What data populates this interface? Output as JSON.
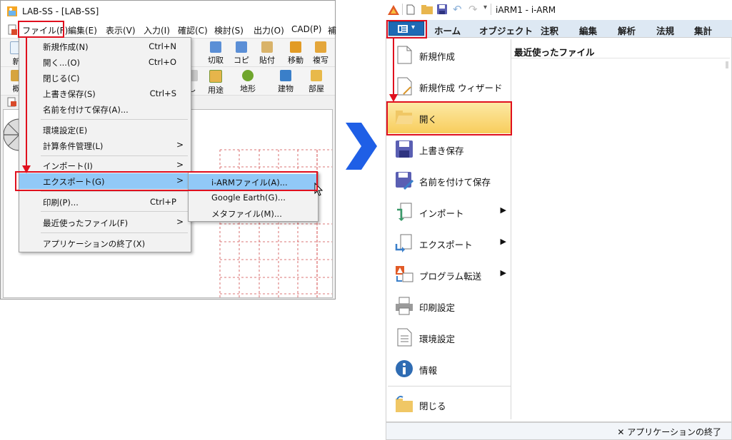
{
  "left_window": {
    "title": "LAB-SS - [LAB-SS]",
    "menubar": [
      "ファイル(F)",
      "編集(E)",
      "表示(V)",
      "入力(I)",
      "確認(C)",
      "検討(S)",
      "出力(O)",
      "CAD(P)",
      "補"
    ],
    "toolbar1": [
      {
        "label": "新",
        "icon": "new-doc-icon"
      },
      {
        "label": "切取",
        "icon": "cut-icon"
      },
      {
        "label": "コピー",
        "icon": "copy-icon"
      },
      {
        "label": "貼付",
        "icon": "paste-icon"
      },
      {
        "label": "移動",
        "icon": "truck-move-icon"
      },
      {
        "label": "複写",
        "icon": "duplicate-icon"
      }
    ],
    "toolbar2": [
      {
        "label": "概",
        "icon": "overview-icon"
      },
      {
        "label": "し",
        "icon": "misc-icon"
      },
      {
        "label": "用途",
        "icon": "usage-icon"
      },
      {
        "label": "地形",
        "icon": "terrain-icon"
      },
      {
        "label": "建物",
        "icon": "building-icon"
      },
      {
        "label": "部屋",
        "icon": "room-icon"
      }
    ],
    "file_menu": [
      {
        "label": "新規作成(N)",
        "shortcut": "Ctrl+N"
      },
      {
        "label": "開く...(O)",
        "shortcut": "Ctrl+O"
      },
      {
        "label": "閉じる(C)",
        "shortcut": ""
      },
      {
        "label": "上書き保存(S)",
        "shortcut": "Ctrl+S"
      },
      {
        "label": "名前を付けて保存(A)...",
        "shortcut": ""
      },
      {
        "label": "環境設定(E)",
        "shortcut": ""
      },
      {
        "label": "計算条件管理(L)",
        "shortcut": "",
        "submenu": true
      },
      {
        "label": "インポート(I)",
        "shortcut": "",
        "submenu": true
      },
      {
        "label": "エクスポート(G)",
        "shortcut": "",
        "submenu": true,
        "highlighted": true
      },
      {
        "label": "印刷(P)...",
        "shortcut": "Ctrl+P"
      },
      {
        "label": "最近使ったファイル(F)",
        "shortcut": "",
        "submenu": true
      },
      {
        "label": "アプリケーションの終了(X)",
        "shortcut": ""
      }
    ],
    "submenu_arrow": ">",
    "export_submenu": [
      "i-ARMファイル(A)...",
      "Google Earth(G)...",
      "メタファイル(M)..."
    ]
  },
  "right_window": {
    "title": "iARM1 - i-ARM",
    "ribbon_tabs": [
      "ホーム",
      "オブジェクト",
      "注釈",
      "編集",
      "解析",
      "法規",
      "集計"
    ],
    "file_menu": [
      {
        "label": "新規作成",
        "icon": "new-doc-icon"
      },
      {
        "label": "新規作成 ウィザード",
        "icon": "wizard-doc-icon"
      },
      {
        "label": "開く",
        "icon": "folder-open-icon",
        "highlighted": true
      },
      {
        "label": "上書き保存",
        "icon": "save-icon"
      },
      {
        "label": "名前を付けて保存",
        "icon": "save-as-icon"
      },
      {
        "label": "インポート",
        "icon": "import-icon",
        "submenu": true
      },
      {
        "label": "エクスポート",
        "icon": "export-icon",
        "submenu": true
      },
      {
        "label": "プログラム転送",
        "icon": "program-transfer-icon",
        "submenu": true
      },
      {
        "label": "印刷設定",
        "icon": "print-icon"
      },
      {
        "label": "環境設定",
        "icon": "settings-doc-icon"
      },
      {
        "label": "情報",
        "icon": "info-icon"
      },
      {
        "label": "閉じる",
        "icon": "folder-close-icon"
      }
    ],
    "submenu_arrow": "▶",
    "recent_header": "最近使ったファイル",
    "exit_label": "✕  アプリケーションの終了"
  },
  "colors": {
    "highlight_red": "#e0101e",
    "arrow_blue": "#1f5fe6",
    "ribbon_blue": "#1d6ab5"
  }
}
